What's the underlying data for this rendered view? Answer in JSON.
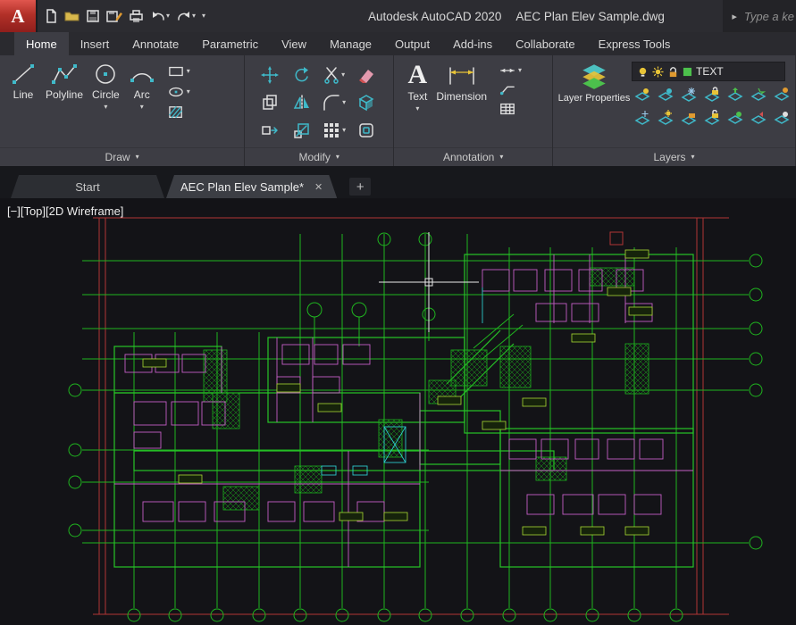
{
  "title_bar": {
    "app_title": "Autodesk AutoCAD 2020",
    "doc_title": "AEC Plan Elev Sample.dwg",
    "search_placeholder": "Type a ke"
  },
  "icons": {
    "logo_letter": "A",
    "chevron_down": "▾",
    "chevron_right": "▸",
    "close": "✕",
    "plus": "+",
    "text_tool": "A"
  },
  "ribbon": {
    "tabs": [
      "Home",
      "Insert",
      "Annotate",
      "Parametric",
      "View",
      "Manage",
      "Output",
      "Add-ins",
      "Collaborate",
      "Express Tools"
    ],
    "panels": {
      "draw": {
        "label": "Draw",
        "line": "Line",
        "polyline": "Polyline",
        "circle": "Circle",
        "arc": "Arc"
      },
      "modify": {
        "label": "Modify"
      },
      "annotation": {
        "label": "Annotation",
        "text": "Text",
        "dimension": "Dimension"
      },
      "layers": {
        "label": "Layers",
        "layer_properties": "Layer Properties",
        "current_layer": "TEXT"
      }
    }
  },
  "file_tabs": {
    "start": "Start",
    "current": "AEC Plan Elev Sample*"
  },
  "viewport": {
    "minimize": "[−]",
    "view_name": "[Top]",
    "visual_style": "[2D Wireframe]"
  },
  "colors": {
    "drawing_green": "#1fb41f",
    "drawing_red": "#b23434",
    "drawing_magenta": "#c55fc5",
    "drawing_cyan": "#2cc9c9",
    "canvas_background": "#131317"
  }
}
